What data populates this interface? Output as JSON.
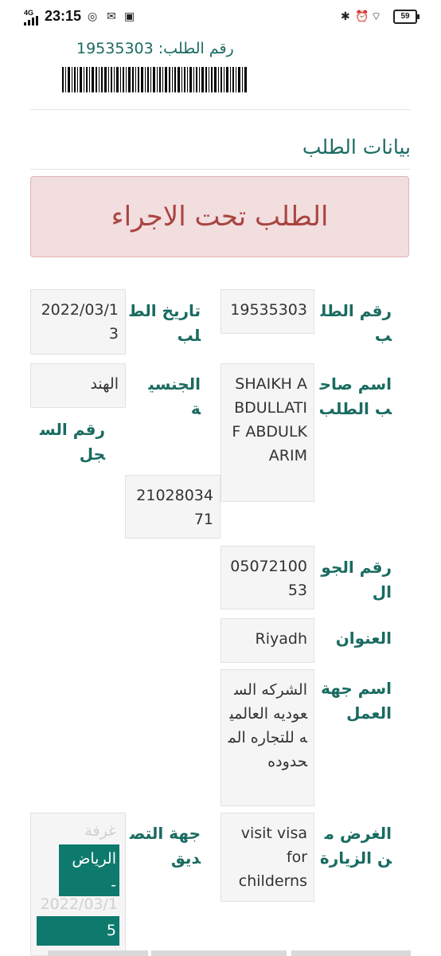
{
  "status_bar": {
    "time": "23:15",
    "network": "4G",
    "battery": "59"
  },
  "header": {
    "order_label": "رقم الطلب: 19535303"
  },
  "section_title": "بيانات الطلب",
  "alert_text": "الطلب تحت الاجراء",
  "fields": {
    "request_number_label": "رقم الطلب",
    "request_number": "19535303",
    "request_date_label": "تاريخ الطلب",
    "request_date": "2022/03/13",
    "applicant_name_label": "اسم صاحب الطلب",
    "applicant_name": "SHAIKH ABDULLATIF ABDULKARIM",
    "nationality_label": "الجنسية",
    "nationality": "الهند",
    "registry_number_label": "رقم السجل",
    "registry_number": "2102803471",
    "mobile_label": "رقم الجوال",
    "mobile": "0507210053",
    "address_label": "العنوان",
    "address": "Riyadh",
    "employer_label": "اسم جهة العمل",
    "employer": "الشركه السعوديه العالميه للتجاره المحدوده",
    "visit_purpose_label": "الغرض من الزيارة",
    "visit_purpose": "visit visa for childerns",
    "attestation_label": "جهة التصديق",
    "attestation_faded_top": "غرفة",
    "attestation_city": "الرياض",
    "attestation_dash": "-",
    "attestation_date_faded": "2022/03/1",
    "attestation_date_end": "5"
  }
}
